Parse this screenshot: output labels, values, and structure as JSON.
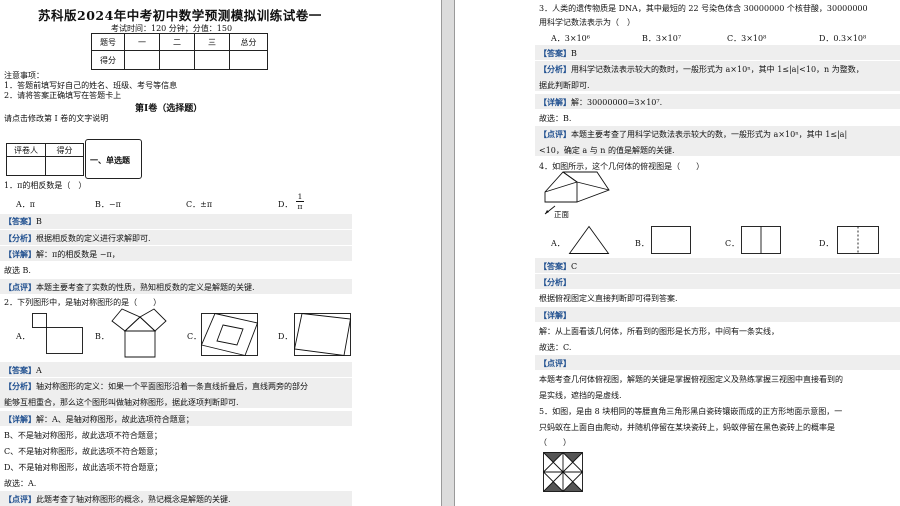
{
  "left": {
    "title": "苏科版2024年中考初中数学预测模拟训练试卷一",
    "exam_info": "考试时间：120 分钟；分值：150",
    "score_table": {
      "headers": [
        "题号",
        "一",
        "二",
        "三",
        "总分"
      ],
      "row_label": "得分"
    },
    "notes_title": "注意事项：",
    "notes": [
      "1．答题前填写好自己的姓名、班级、考号等信息",
      "2．请将答案正确填写在答题卡上"
    ],
    "section_title": "第Ⅰ卷（选择题）",
    "section_hint": "请点击修改第 I 卷的文字说明",
    "grader_table": {
      "col1": "评卷人",
      "col2": "得分"
    },
    "part_title": "一、单选题",
    "q1": {
      "stem": "1．π的相反数是（　）",
      "options": [
        "A．π",
        "B．−π",
        "C．±π",
        "D．"
      ],
      "option_d_num": "1",
      "option_d_den": "π",
      "answer_tag": "【答案】",
      "answer": "B",
      "analysis_tag": "【分析】",
      "analysis": "根据相反数的定义进行求解即可.",
      "detail_tag": "【详解】",
      "detail": "解：π的相反数是 −π，",
      "conclusion": "故选 B.",
      "comment_tag": "【点评】",
      "comment": "本题主要考查了实数的性质，熟知相反数的定义是解题的关键."
    },
    "q2": {
      "stem": "2．下列图形中，是轴对称图形的是（　　）",
      "options": [
        "A．",
        "B．",
        "C．",
        "D．"
      ],
      "answer_tag": "【答案】",
      "answer": "A",
      "analysis_tag": "【分析】",
      "analysis_line1": "轴对称图形的定义：如果一个平面图形沿着一条直线折叠后，直线两旁的部分",
      "analysis_line2": "能够互相重合，那么这个图形叫做轴对称图形，据此逐项判断即可.",
      "detail_tag": "【详解】",
      "detail": "解：A、是轴对称图形，故此选项符合题意；",
      "lines": [
        "B、不是轴对称图形，故此选项不符合题意；",
        "C、不是轴对称图形，故此选项不符合题意；",
        "D、不是轴对称图形，故此选项不符合题意；"
      ],
      "conclusion": "故选：A.",
      "comment_tag": "【点评】",
      "comment": "此题考查了轴对称图形的概念，熟记概念是解题的关键."
    }
  },
  "right": {
    "q3": {
      "stem_line1": "3．人类的遗传物质是 DNA，其中最短的 22 号染色体含 30000000 个核苷酸，30000000",
      "stem_line2": "用科学记数法表示为（　）",
      "options": [
        "A．3×10⁶",
        "B．3×10⁷",
        "C．3×10⁸",
        "D．0.3×10⁸"
      ],
      "answer_tag": "【答案】",
      "answer": "B",
      "analysis_tag": "【分析】",
      "analysis_line1": "用科学记数法表示较大的数时，一般形式为 a×10ⁿ，其中 1≤|a|<10，n 为整数，",
      "analysis_line2": "据此判断即可.",
      "detail_tag": "【详解】",
      "detail": "解：30000000=3×10⁷.",
      "conclusion": "故选：B.",
      "comment_tag": "【点评】",
      "comment_line1": "本题主要考查了用科学记数法表示较大的数，一般形式为 a×10ⁿ，其中 1≤|a|",
      "comment_line2": "<10，确定 a 与 n 的值是解题的关键."
    },
    "q4": {
      "stem": "4．如图所示，这个几何体的俯视图是（　　）",
      "front_label": "正面",
      "options": [
        "A．",
        "B．",
        "C．",
        "D．"
      ],
      "answer_tag": "【答案】",
      "answer": "C",
      "analysis_tag": "【分析】",
      "analysis": "根据俯视图定义直接判断即可得到答案.",
      "detail_tag": "【详解】",
      "detail": "解：从上面看该几何体，所看到的图形是长方形，中间有一条实线，",
      "conclusion": "故选：C.",
      "comment_tag": "【点评】",
      "comment_line1": "本题考查几何体俯视图，解题的关键是掌握俯视图定义及熟练掌握三视图中直接看到的",
      "comment_line2": "是实线，遮挡的是虚线."
    },
    "q5": {
      "stem_line1": "5．如图，是由 8 块相同的等腰直角三角形黑白瓷砖镶嵌而成的正方形地面示意图，一",
      "stem_line2": "只蚂蚁在上面自由爬动，并随机停留在某块瓷砖上，蚂蚁停留在黑色瓷砖上的概率是",
      "stem_line3": "（　　）"
    }
  }
}
